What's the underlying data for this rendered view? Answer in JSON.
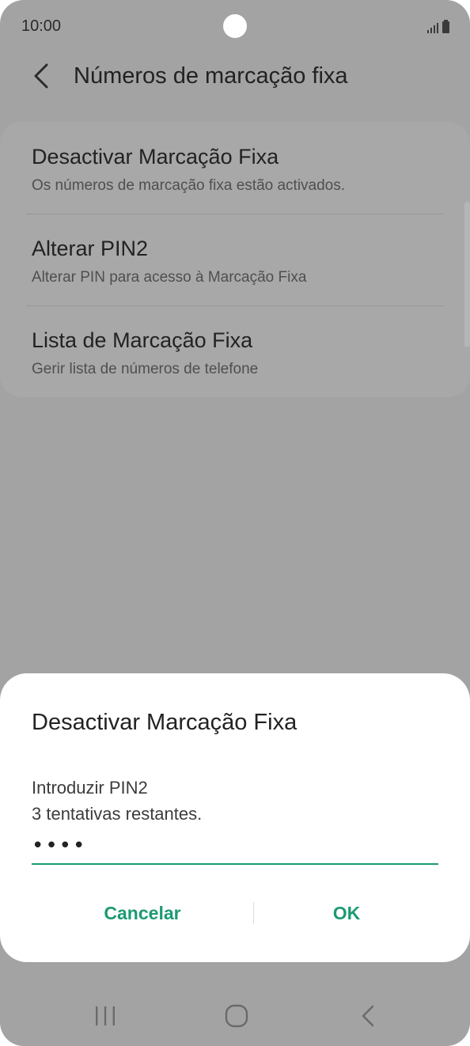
{
  "status_bar": {
    "time": "10:00"
  },
  "header": {
    "title": "Números de marcação fixa"
  },
  "settings": {
    "items": [
      {
        "title": "Desactivar Marcação Fixa",
        "subtitle": "Os números de marcação fixa estão activados."
      },
      {
        "title": "Alterar PIN2",
        "subtitle": "Alterar PIN para acesso à Marcação Fixa"
      },
      {
        "title": "Lista de Marcação Fixa",
        "subtitle": "Gerir lista de números de telefone"
      }
    ]
  },
  "dialog": {
    "title": "Desactivar Marcação Fixa",
    "message": "Introduzir PIN2\n3 tentativas restantes.",
    "pin_value": "••••",
    "cancel_label": "Cancelar",
    "ok_label": "OK"
  },
  "icons": {
    "back": "chevron-left-icon",
    "nav_recents": "recents-icon",
    "nav_home": "home-icon",
    "nav_back": "back-icon"
  },
  "colors": {
    "accent": "#1c9a73",
    "scrim_background": "#a3a3a3",
    "dialog_background": "#ffffff"
  }
}
